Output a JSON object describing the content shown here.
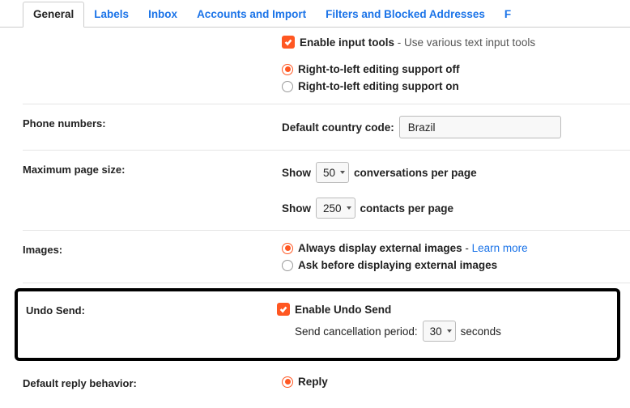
{
  "tabs": {
    "general": "General",
    "labels": "Labels",
    "inbox": "Inbox",
    "accounts": "Accounts and Import",
    "filters": "Filters and Blocked Addresses",
    "forwarding_partial": "F"
  },
  "input_tools": {
    "enable_label": "Enable input tools",
    "desc": " - Use various text input tools"
  },
  "rtl": {
    "off_label": "Right-to-left editing support off",
    "on_label": "Right-to-left editing support on"
  },
  "phone": {
    "section_label": "Phone numbers:",
    "country_label": "Default country code:",
    "country_value": "Brazil"
  },
  "page_size": {
    "section_label": "Maximum page size:",
    "show_prefix": "Show",
    "conv_value": "50",
    "conv_suffix": "conversations per page",
    "contacts_value": "250",
    "contacts_suffix": "contacts per page"
  },
  "images": {
    "section_label": "Images:",
    "always_label": "Always display external images",
    "dash": " - ",
    "learn_more": "Learn more",
    "ask_label": "Ask before displaying external images"
  },
  "undo": {
    "section_label": "Undo Send:",
    "enable_label": "Enable Undo Send",
    "period_label": "Send cancellation period:",
    "period_value": "30",
    "period_suffix": "seconds"
  },
  "reply": {
    "section_label": "Default reply behavior:",
    "reply_label": "Reply"
  }
}
